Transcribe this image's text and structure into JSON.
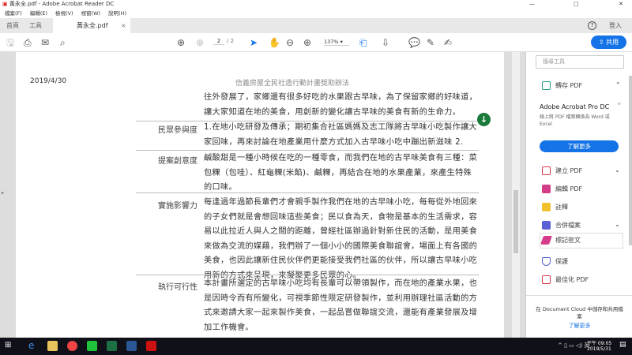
{
  "window": {
    "title": "黃永全.pdf - Adobe Acrobat Reader DC",
    "min": "—",
    "max": "▢",
    "close": "✕"
  },
  "menu": [
    "檔案(F)",
    "編輯(E)",
    "檢視(V)",
    "視窗(W)",
    "說明(H)"
  ],
  "tabs": {
    "home": "首頁",
    "tools": "工具",
    "doc": "黃永全.pdf",
    "close": "×",
    "help": "?",
    "login": "登入"
  },
  "toolbar": {
    "page_current": "2",
    "page_total": "/ 2",
    "zoom": "137%",
    "share": "共用"
  },
  "doc": {
    "date": "2019/4/30",
    "header": "信義房屋全民社造行動計畫獎助辦法",
    "intro": "往外發展了，家鄉還有很多好吃的水果跟古早味，為了保留家鄉的好味道，讓大家知道在地的美食，用創新的變化讓古早味的美食有新的生命力。",
    "rows": [
      {
        "label": "民眾參與度",
        "text": "1.在地小吃研發及傳承；期初集合社區媽媽及志工隊將古早味小吃製作讓大家回味，再來討論在地產業用什麼方式加入古早味小吃中蹦出新滋味 2."
      },
      {
        "label": "提案創意度",
        "text": "鹹酸甜是一種小時候在吃的一種零食，而我們在地的古早味美食有三種：菜包粿（包哇）、紅龜粿(米餡)、鹹粿，再結合在地的水果產業，來產生特殊的口味。"
      },
      {
        "label": "實施影響力",
        "text": "每逢過年過節長輩們才會親手製作我們在地的古早味小吃，每每從外地回來的子女們就是會想回味這些美食；民以食為天，食物是基本的生活需求，容易以此拉近人與人之間的距離，曾經社區辦過針對新住民的活動，是用美食來做為交流的媒藉，我們辦了一個小小的國際美食聯誼會，場面上有各國的美食，也因此讓新住民伙伴們更能接受我們社區的伙伴，所以讓古早味小吃用新的方式來呈現，來擬聚更多民眾的心。"
      },
      {
        "label": "執行可行性",
        "text": "本計畫所選定的古早味小吃均有長輩可以帶領製作，而在地的產業水果，也是因時令而有所變化，可視季節性限定研發製作，並利用辦理社區活動的方式來邀請大家一起來製作美食，一起品嘗做聯誼交流，還能有產業發展及增加工作機會。"
      }
    ]
  },
  "panel": {
    "search_placeholder": "搜尋工具",
    "export": "轉存 PDF",
    "promo_title": "Adobe Acrobat Pro DC",
    "promo_desc": "線上將 PDF 檔案轉換為 Word 或 Excel",
    "learn_more": "了解更多",
    "items": [
      "建立 PDF",
      "編輯 PDF",
      "註釋",
      "合併檔案",
      "標記密文",
      "保護",
      "最佳化 PDF"
    ],
    "cloud_text": "在 Document Cloud 中儲存和共用檔案",
    "cloud_link": "了解更多"
  },
  "taskbar": {
    "time": "下午 09:05",
    "date": "2019/5/31"
  },
  "colors": {
    "accent": "#1473e6",
    "green": "#1a7a3a"
  }
}
